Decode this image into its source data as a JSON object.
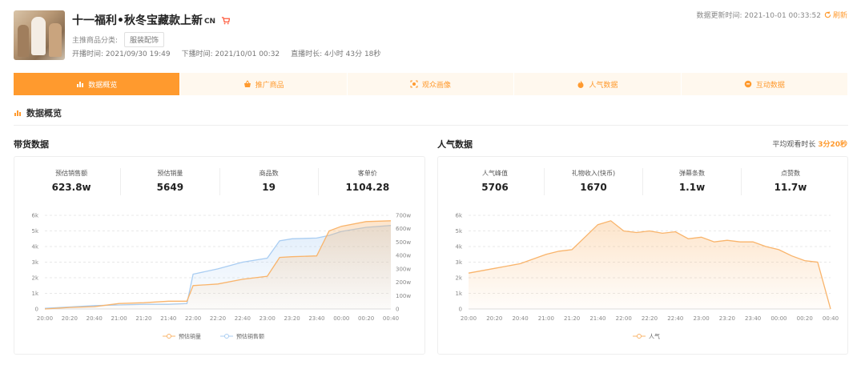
{
  "header": {
    "title": "十一福利•秋冬宝藏款上新",
    "title_suffix": "CN",
    "category_label": "主推商品分类:",
    "category_value": "服装配饰",
    "start_time": "开播时间: 2021/09/30 19:49",
    "end_time": "下播时间: 2021/10/01 00:32",
    "duration": "直播时长: 4小时 43分 18秒",
    "update_time": "数据更新时间: 2021-10-01 00:33:52",
    "refresh_label": "刷新"
  },
  "tabs": [
    {
      "label": "数据概览",
      "icon": "bar-chart-icon",
      "active": true
    },
    {
      "label": "推广商品",
      "icon": "basket-icon",
      "active": false
    },
    {
      "label": "观众画像",
      "icon": "scan-face-icon",
      "active": false
    },
    {
      "label": "人气数据",
      "icon": "fire-icon",
      "active": false
    },
    {
      "label": "互动数据",
      "icon": "chat-icon",
      "active": false
    }
  ],
  "section_title": "数据概览",
  "sales": {
    "title": "带货数据",
    "stats": [
      {
        "label": "预估销售额",
        "value": "623.8w"
      },
      {
        "label": "预估销量",
        "value": "5649"
      },
      {
        "label": "商品数",
        "value": "19"
      },
      {
        "label": "客单价",
        "value": "1104.28"
      }
    ]
  },
  "popularity": {
    "title": "人气数据",
    "avg_label": "平均观看时长",
    "avg_value": "3分20秒",
    "stats": [
      {
        "label": "人气峰值",
        "value": "5706"
      },
      {
        "label": "礼物收入(快币)",
        "value": "1670"
      },
      {
        "label": "弹幕条数",
        "value": "1.1w"
      },
      {
        "label": "点赞数",
        "value": "11.7w"
      }
    ]
  },
  "colors": {
    "accent": "#ff9a2e",
    "orange_line": "#f9b46b",
    "blue_line": "#a9cdf2"
  },
  "chart_data": [
    {
      "type": "line",
      "x": [
        "20:00",
        "20:20",
        "20:40",
        "21:00",
        "21:20",
        "21:40",
        "22:00",
        "22:20",
        "22:40",
        "23:00",
        "23:20",
        "23:40",
        "00:00",
        "00:20",
        "00:40"
      ],
      "ylim": [
        0,
        6000
      ],
      "yticks": [
        "0",
        "1k",
        "2k",
        "3k",
        "4k",
        "5k",
        "6k"
      ],
      "y2lim": [
        0,
        700
      ],
      "y2ticks": [
        "0",
        "100w",
        "200w",
        "300w",
        "400w",
        "500w",
        "600w",
        "700w"
      ],
      "series": [
        {
          "name": "预估销量",
          "axis": "left",
          "color": "#f9b46b",
          "points": [
            [
              "20:00",
              0
            ],
            [
              "20:20",
              100
            ],
            [
              "20:40",
              150
            ],
            [
              "21:00",
              350
            ],
            [
              "21:20",
              400
            ],
            [
              "21:40",
              500
            ],
            [
              "21:55",
              500
            ],
            [
              "22:00",
              1500
            ],
            [
              "22:20",
              1600
            ],
            [
              "22:40",
              1900
            ],
            [
              "23:00",
              2100
            ],
            [
              "23:10",
              3300
            ],
            [
              "23:20",
              3350
            ],
            [
              "23:40",
              3400
            ],
            [
              "23:50",
              5000
            ],
            [
              "00:00",
              5300
            ],
            [
              "00:20",
              5600
            ],
            [
              "00:40",
              5650
            ]
          ]
        },
        {
          "name": "预估销售额",
          "axis": "right",
          "color": "#a9cdf2",
          "points": [
            [
              "20:00",
              5
            ],
            [
              "20:20",
              15
            ],
            [
              "20:40",
              25
            ],
            [
              "21:00",
              30
            ],
            [
              "21:20",
              35
            ],
            [
              "21:40",
              35
            ],
            [
              "21:55",
              40
            ],
            [
              "22:00",
              260
            ],
            [
              "22:20",
              300
            ],
            [
              "22:40",
              350
            ],
            [
              "23:00",
              380
            ],
            [
              "23:10",
              510
            ],
            [
              "23:20",
              525
            ],
            [
              "23:40",
              530
            ],
            [
              "23:50",
              550
            ],
            [
              "00:00",
              580
            ],
            [
              "00:20",
              610
            ],
            [
              "00:40",
              624
            ]
          ]
        }
      ]
    },
    {
      "type": "line",
      "x": [
        "20:00",
        "20:20",
        "20:40",
        "21:00",
        "21:20",
        "21:40",
        "22:00",
        "22:20",
        "22:40",
        "23:00",
        "23:20",
        "23:40",
        "00:00",
        "00:20",
        "00:40"
      ],
      "ylim": [
        0,
        6000
      ],
      "yticks": [
        "0",
        "1k",
        "2k",
        "3k",
        "4k",
        "5k",
        "6k"
      ],
      "series": [
        {
          "name": "人气",
          "color": "#f9b46b",
          "points": [
            [
              "20:00",
              2300
            ],
            [
              "20:20",
              2600
            ],
            [
              "20:40",
              2900
            ],
            [
              "21:00",
              3500
            ],
            [
              "21:10",
              3700
            ],
            [
              "21:20",
              3800
            ],
            [
              "21:30",
              4600
            ],
            [
              "21:40",
              5400
            ],
            [
              "21:50",
              5650
            ],
            [
              "22:00",
              5000
            ],
            [
              "22:10",
              4900
            ],
            [
              "22:20",
              5000
            ],
            [
              "22:30",
              4850
            ],
            [
              "22:40",
              4950
            ],
            [
              "22:50",
              4500
            ],
            [
              "23:00",
              4600
            ],
            [
              "23:10",
              4300
            ],
            [
              "23:20",
              4400
            ],
            [
              "23:30",
              4300
            ],
            [
              "23:40",
              4300
            ],
            [
              "23:50",
              4000
            ],
            [
              "00:00",
              3800
            ],
            [
              "00:10",
              3400
            ],
            [
              "00:20",
              3100
            ],
            [
              "00:30",
              3000
            ],
            [
              "00:40",
              0
            ]
          ]
        }
      ]
    }
  ]
}
